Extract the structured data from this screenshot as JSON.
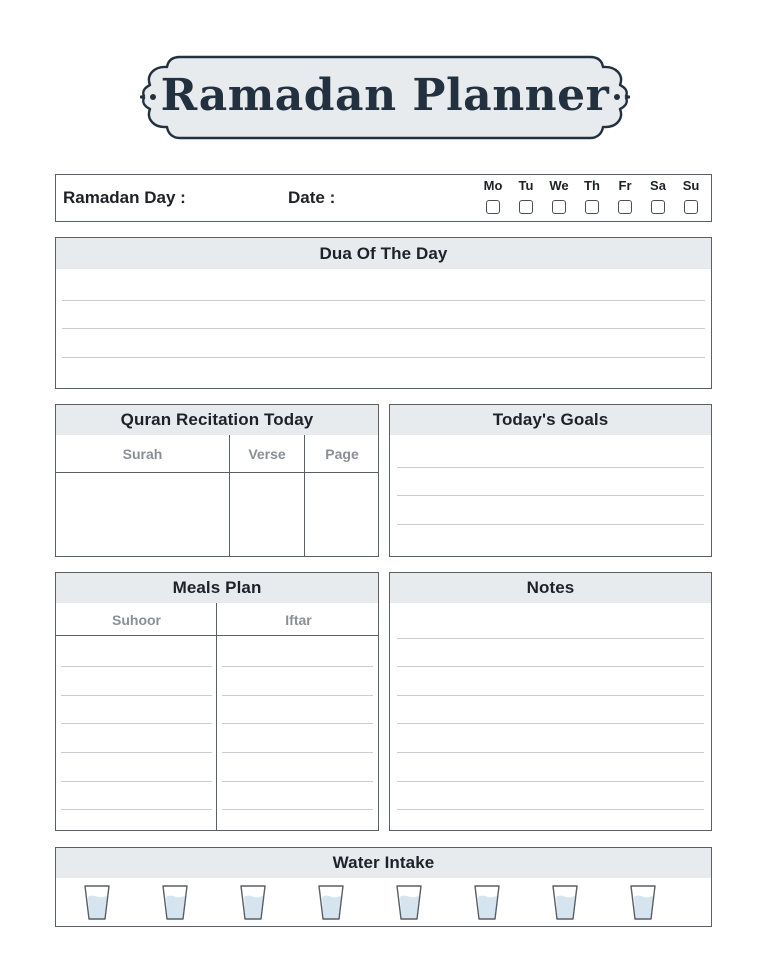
{
  "title": "Ramadan Planner",
  "info_row": {
    "ramadan_day_label": "Ramadan Day :",
    "ramadan_day_value": "",
    "date_label": "Date :",
    "date_value": "",
    "days": [
      {
        "label": "Mo",
        "checked": false
      },
      {
        "label": "Tu",
        "checked": false
      },
      {
        "label": "We",
        "checked": false
      },
      {
        "label": "Th",
        "checked": false
      },
      {
        "label": "Fr",
        "checked": false
      },
      {
        "label": "Sa",
        "checked": false
      },
      {
        "label": "Su",
        "checked": false
      }
    ]
  },
  "dua": {
    "heading": "Dua Of The Day",
    "lines": [
      "",
      "",
      ""
    ]
  },
  "quran": {
    "heading": "Quran Recitation Today",
    "columns": [
      "Surah",
      "Verse",
      "Page"
    ],
    "row": {
      "surah": "",
      "verse": "",
      "page": ""
    }
  },
  "goals": {
    "heading": "Today's Goals",
    "lines": [
      "",
      "",
      ""
    ]
  },
  "meals": {
    "heading": "Meals Plan",
    "columns": [
      "Suhoor",
      "Iftar"
    ],
    "suhoor_lines": [
      "",
      "",
      "",
      "",
      "",
      ""
    ],
    "iftar_lines": [
      "",
      "",
      "",
      "",
      "",
      ""
    ]
  },
  "notes": {
    "heading": "Notes",
    "lines": [
      "",
      "",
      "",
      "",
      "",
      "",
      ""
    ]
  },
  "water": {
    "heading": "Water Intake",
    "glasses": 8,
    "glass_icon": "water-glass-icon",
    "glass_fill_fraction": 0.7
  },
  "colors": {
    "ink": "#23303f",
    "border": "#5a5f66",
    "band": "#e8ebee",
    "rule": "#c9ccd0",
    "subhead": "#8a8f96",
    "water": "#d6e4ef"
  }
}
